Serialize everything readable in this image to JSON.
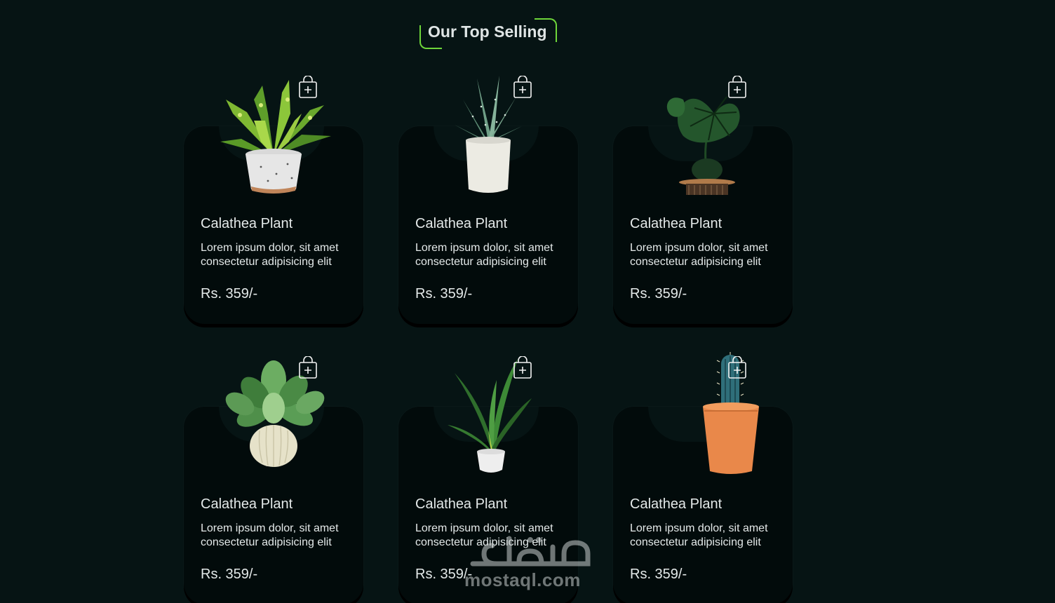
{
  "section": {
    "title": "Our Top Selling",
    "accent_color": "#6ed63a"
  },
  "products": [
    {
      "name": "Calathea Plant",
      "description": "Lorem ipsum dolor, sit amet consectetur adipisicing elit",
      "price": "Rs. 359/-",
      "image": "variegated-plant-in-speckled-pot",
      "cart_icon": "shopping-bag-plus-icon"
    },
    {
      "name": "Calathea Plant",
      "description": "Lorem ipsum dolor, sit amet consectetur adipisicing elit",
      "price": "Rs. 359/-",
      "image": "succulent-in-white-pot",
      "cart_icon": "shopping-bag-plus-icon"
    },
    {
      "name": "Calathea Plant",
      "description": "Lorem ipsum dolor, sit amet consectetur adipisicing elit",
      "price": "Rs. 359/-",
      "image": "monstera-in-dark-pot-on-stand",
      "cart_icon": "shopping-bag-plus-icon"
    },
    {
      "name": "Calathea Plant",
      "description": "Lorem ipsum dolor, sit amet consectetur adipisicing elit",
      "price": "Rs. 359/-",
      "image": "pothos-in-ribbed-cream-vase",
      "cart_icon": "shopping-bag-plus-icon"
    },
    {
      "name": "Calathea Plant",
      "description": "Lorem ipsum dolor, sit amet consectetur adipisicing elit",
      "price": "Rs. 359/-",
      "image": "snake-plant-in-small-white-pot",
      "cart_icon": "shopping-bag-plus-icon"
    },
    {
      "name": "Calathea Plant",
      "description": "Lorem ipsum dolor, sit amet consectetur adipisicing elit",
      "price": "Rs. 359/-",
      "image": "cactus-in-terracotta-pot",
      "cart_icon": "shopping-bag-plus-icon"
    }
  ],
  "watermark": {
    "latin": "mostaql.com",
    "arabic": "مستقل"
  },
  "colors": {
    "background": "#061414",
    "card": "#020b0b",
    "text": "#e4e9e9"
  }
}
